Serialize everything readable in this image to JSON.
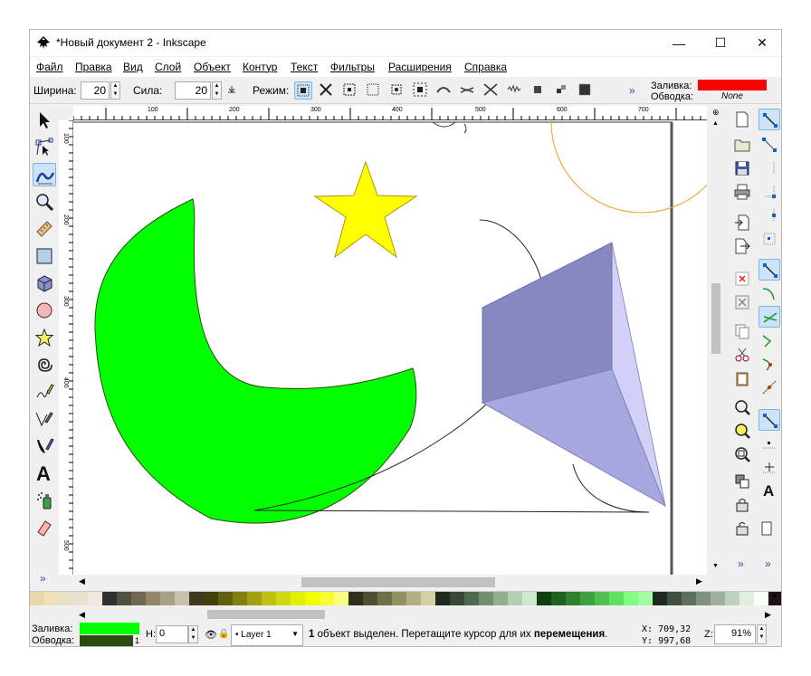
{
  "window": {
    "title": "*Новый документ 2 - Inkscape",
    "minimize": "—",
    "maximize": "☐",
    "close": "✕"
  },
  "menu": [
    "Файл",
    "Правка",
    "Вид",
    "Слой",
    "Объект",
    "Контур",
    "Текст",
    "Фильтры",
    "Расширения",
    "Справка"
  ],
  "controls": {
    "width_label": "Ширина:",
    "width_value": "20",
    "force_label": "Сила:",
    "force_value": "20",
    "mode_label": "Режим:",
    "overflow": "»",
    "fill_label": "Заливка:",
    "stroke_label": "Обводка:",
    "stroke_value": "None",
    "fill_color": "#ff0000"
  },
  "rulers": {
    "h_labels": [
      "100",
      "200",
      "300",
      "400",
      "500",
      "600",
      "700"
    ],
    "v_labels": [
      "100",
      "200",
      "300",
      "400",
      "500"
    ]
  },
  "toolbox": {
    "overflow": "»",
    "tools": [
      "selector-tool-icon",
      "node-tool-icon",
      "tweak-tool-icon",
      "zoom-tool-icon",
      "measure-tool-icon",
      "rectangle-tool-icon",
      "3d-box-tool-icon",
      "ellipse-tool-icon",
      "star-tool-icon",
      "spiral-tool-icon",
      "pencil-tool-icon",
      "pen-tool-icon",
      "calligraphy-tool-icon",
      "text-tool-icon",
      "spray-tool-icon",
      "eraser-tool-icon"
    ],
    "active_tool": "tweak-tool-icon"
  },
  "commands": {
    "overflow": "»"
  },
  "snap": {
    "overflow": "»"
  },
  "palette": [
    "#e8d8a8",
    "#f0e0b8",
    "#e8e0c8",
    "#e8e0d0",
    "#f0e8e0",
    "#303030",
    "#505040",
    "#706850",
    "#908868",
    "#a8a088",
    "#c8c0a8",
    "#403820",
    "#404010",
    "#606010",
    "#808010",
    "#a0a010",
    "#c0c010",
    "#d0d810",
    "#e0f000",
    "#f0ff00",
    "#f8ff30",
    "#f8ff80",
    "#303018",
    "#505030",
    "#707048",
    "#909060",
    "#b0b080",
    "#d0d0a0",
    "#202820",
    "#384838",
    "#506850",
    "#709070",
    "#90b090",
    "#b0d0b0",
    "#d0e8d0",
    "#104010",
    "#206020",
    "#308030",
    "#40a040",
    "#50c050",
    "#60e060",
    "#80ff80",
    "#a0ffa0",
    "#202820",
    "#405040",
    "#607060",
    "#809080",
    "#a0b0a0",
    "#c0d0c0",
    "#e0f0e0",
    "#f8fff8",
    "#201018"
  ],
  "status": {
    "fill_label": "Заливка:",
    "stroke_label": "Обводка:",
    "stroke_width": "1",
    "fill_color": "#00ff00",
    "stroke_color": "#2e4a13",
    "h_label": "H:",
    "h_value": "0",
    "layer": "Layer 1",
    "msg_count": "1",
    "msg_text": " объект выделен. Перетащите курсор для их ",
    "msg_bold": "перемещения",
    "msg_end": ".",
    "x_label": "X:",
    "x_value": "709,32",
    "y_label": "Y:",
    "y_value": "997,68",
    "zoom_label": "Z:",
    "zoom_value": "91%"
  }
}
